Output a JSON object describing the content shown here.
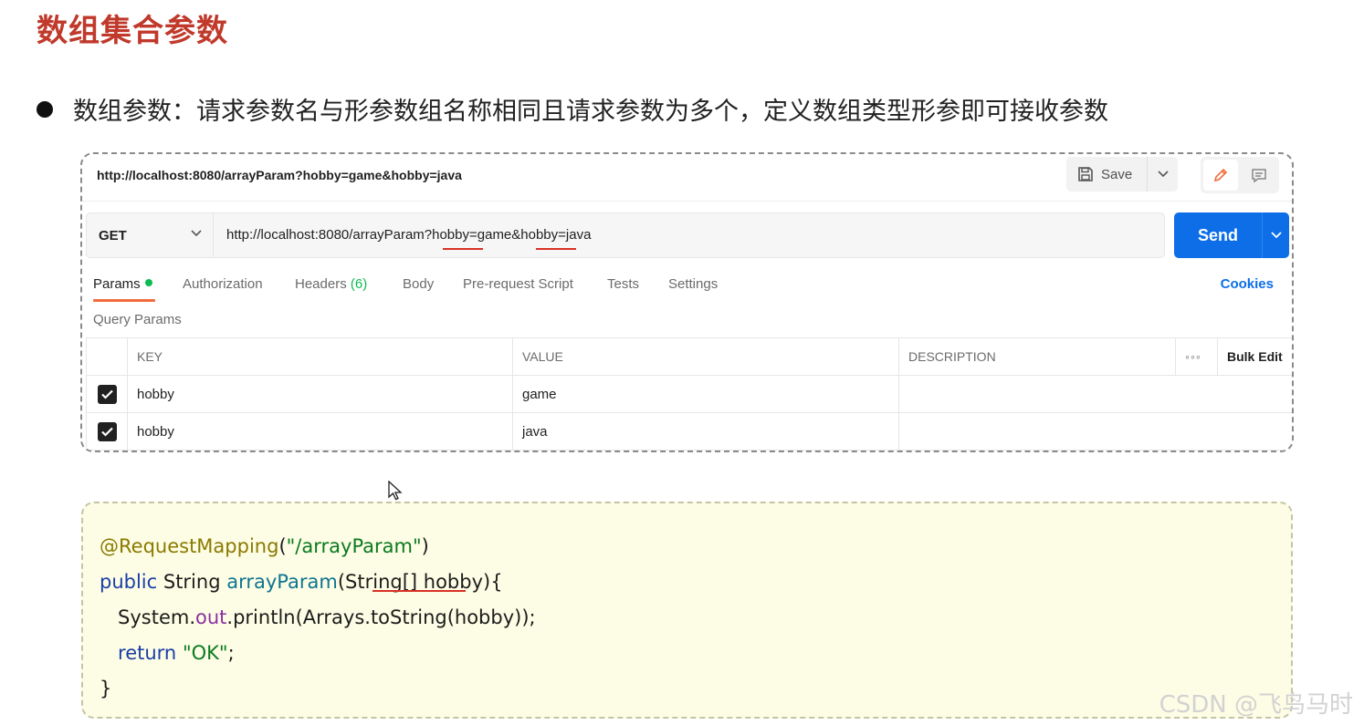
{
  "slide": {
    "title": "数组集合参数",
    "bullet": "数组参数：请求参数名与形参数组名称相同且请求参数为多个，定义数组类型形参即可接收参数"
  },
  "request": {
    "title": "http://localhost:8080/arrayParam?hobby=game&hobby=java",
    "save_label": "Save",
    "method": "GET",
    "url": "http://localhost:8080/arrayParam?hobby=game&hobby=java",
    "send_label": "Send"
  },
  "tabs": {
    "params": "Params",
    "authorization": "Authorization",
    "headers": "Headers",
    "headers_count": "(6)",
    "body": "Body",
    "prerequest": "Pre-request Script",
    "tests": "Tests",
    "settings": "Settings",
    "cookies": "Cookies"
  },
  "query": {
    "title": "Query Params",
    "columns": {
      "key": "KEY",
      "value": "VALUE",
      "description": "DESCRIPTION",
      "bulk": "Bulk Edit"
    },
    "rows": [
      {
        "key": "hobby",
        "value": "game",
        "description": "",
        "checked": true
      },
      {
        "key": "hobby",
        "value": "java",
        "description": "",
        "checked": true
      }
    ]
  },
  "code": {
    "l1_annotation": "@RequestMapping",
    "l1_open": "(",
    "l1_string": "\"/arrayParam\"",
    "l1_close": ")",
    "l2_kw": "public",
    "l2_type": " String ",
    "l2_fn": "arrayParam",
    "l2_rest": "(String[] hobby){",
    "l3_indent": "   ",
    "l3_pre": "System.",
    "l3_field": "out",
    "l3_post": ".println(Arrays.toString(hobby));",
    "l4_indent": "   ",
    "l4_kw": "return",
    "l4_space": " ",
    "l4_string": "\"OK\"",
    "l4_end": ";",
    "l5": "}"
  },
  "watermark": "CSDN @飞鸟马时",
  "colors": {
    "title_red": "#c0392b",
    "send_blue": "#0d6ee8",
    "active_tab_orange": "#f26b3a",
    "status_green": "#0cbb52",
    "code_bg": "#fdfde5"
  }
}
